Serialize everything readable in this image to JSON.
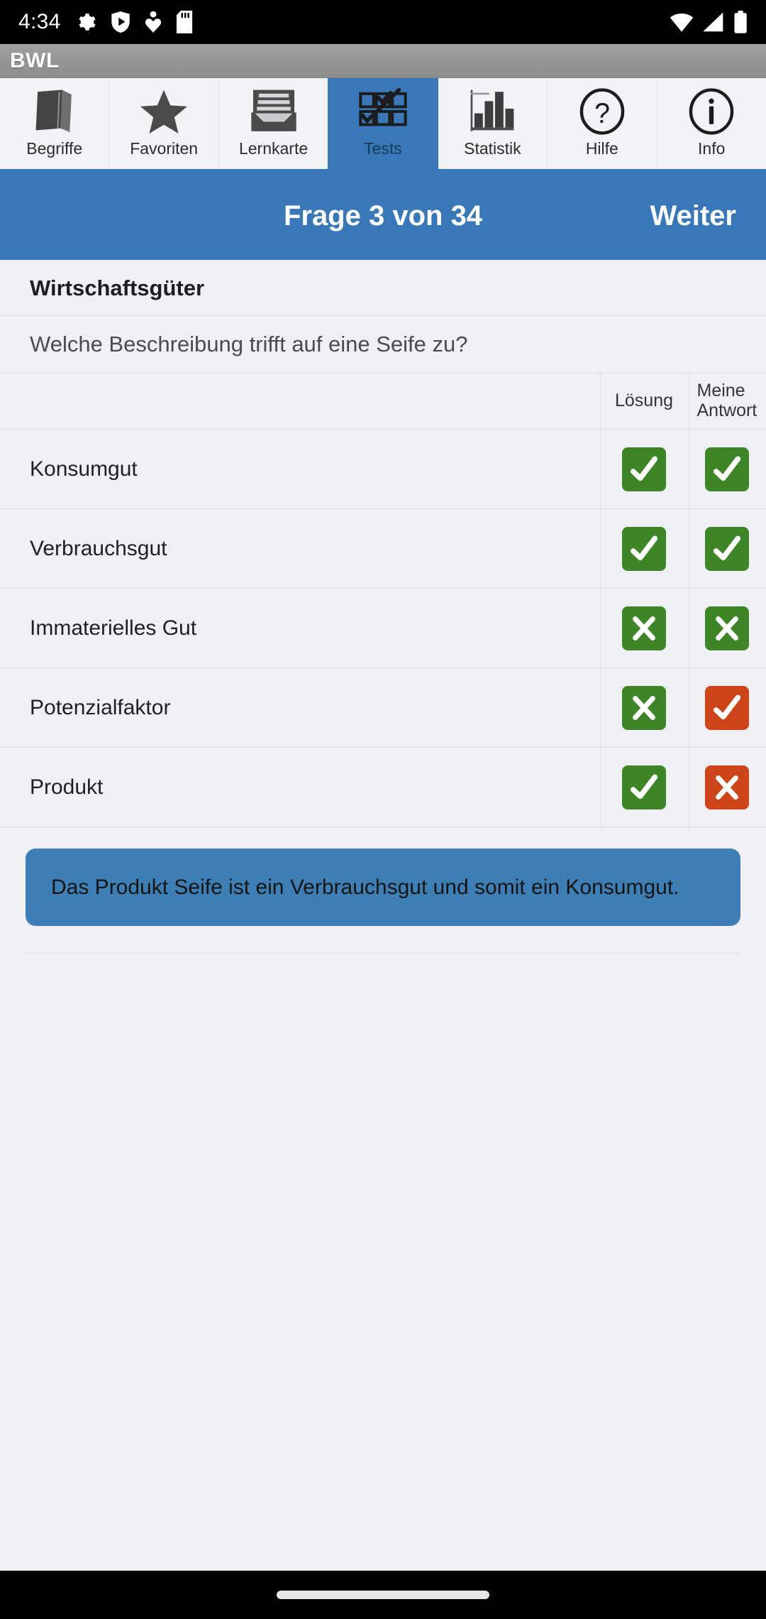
{
  "statusbar": {
    "time": "4:34",
    "left_icons": [
      "gear-icon",
      "play-shield-icon",
      "location-heart-icon",
      "sd-card-icon"
    ],
    "right_icons": [
      "wifi-icon",
      "signal-icon",
      "battery-icon"
    ]
  },
  "titlebar": {
    "app_title": "BWL"
  },
  "tabs": [
    {
      "label": "Begriffe",
      "icon": "book-icon",
      "active": false
    },
    {
      "label": "Favoriten",
      "icon": "star-icon",
      "active": false
    },
    {
      "label": "Lernkarte",
      "icon": "card-box-icon",
      "active": false
    },
    {
      "label": "Tests",
      "icon": "checkgrid-icon",
      "active": true
    },
    {
      "label": "Statistik",
      "icon": "bar-chart-icon",
      "active": false
    },
    {
      "label": "Hilfe",
      "icon": "question-icon",
      "active": false
    },
    {
      "label": "Info",
      "icon": "info-icon",
      "active": false
    }
  ],
  "question_header": {
    "title": "Frage 3 von 34",
    "next_label": "Weiter"
  },
  "topic": "Wirtschaftsgüter",
  "question": "Welche Beschreibung trifft auf eine Seife zu?",
  "table": {
    "headers": {
      "label": "",
      "solution": "Lösung",
      "mine": "Meine Antwort"
    },
    "rows": [
      {
        "label": "Konsumgut",
        "solution": "check",
        "solution_color": "green",
        "mine": "check",
        "mine_color": "green"
      },
      {
        "label": "Verbrauchsgut",
        "solution": "check",
        "solution_color": "green",
        "mine": "check",
        "mine_color": "green"
      },
      {
        "label": "Immaterielles Gut",
        "solution": "cross",
        "solution_color": "green",
        "mine": "cross",
        "mine_color": "green"
      },
      {
        "label": "Potenzialfaktor",
        "solution": "cross",
        "solution_color": "green",
        "mine": "check",
        "mine_color": "red"
      },
      {
        "label": "Produkt",
        "solution": "check",
        "solution_color": "green",
        "mine": "cross",
        "mine_color": "red"
      }
    ]
  },
  "explanation": "Das Produkt Seife ist ein Verbrauchsgut und somit ein Konsumgut.",
  "colors": {
    "accent_blue": "#3878b8",
    "explanation_blue": "#3d7fb5",
    "correct_green": "#3d8527",
    "wrong_red": "#cc4418",
    "page_bg": "#eff0f4",
    "titlebar_gray": "#949494"
  },
  "navbar": {
    "pill": "home-pill"
  }
}
